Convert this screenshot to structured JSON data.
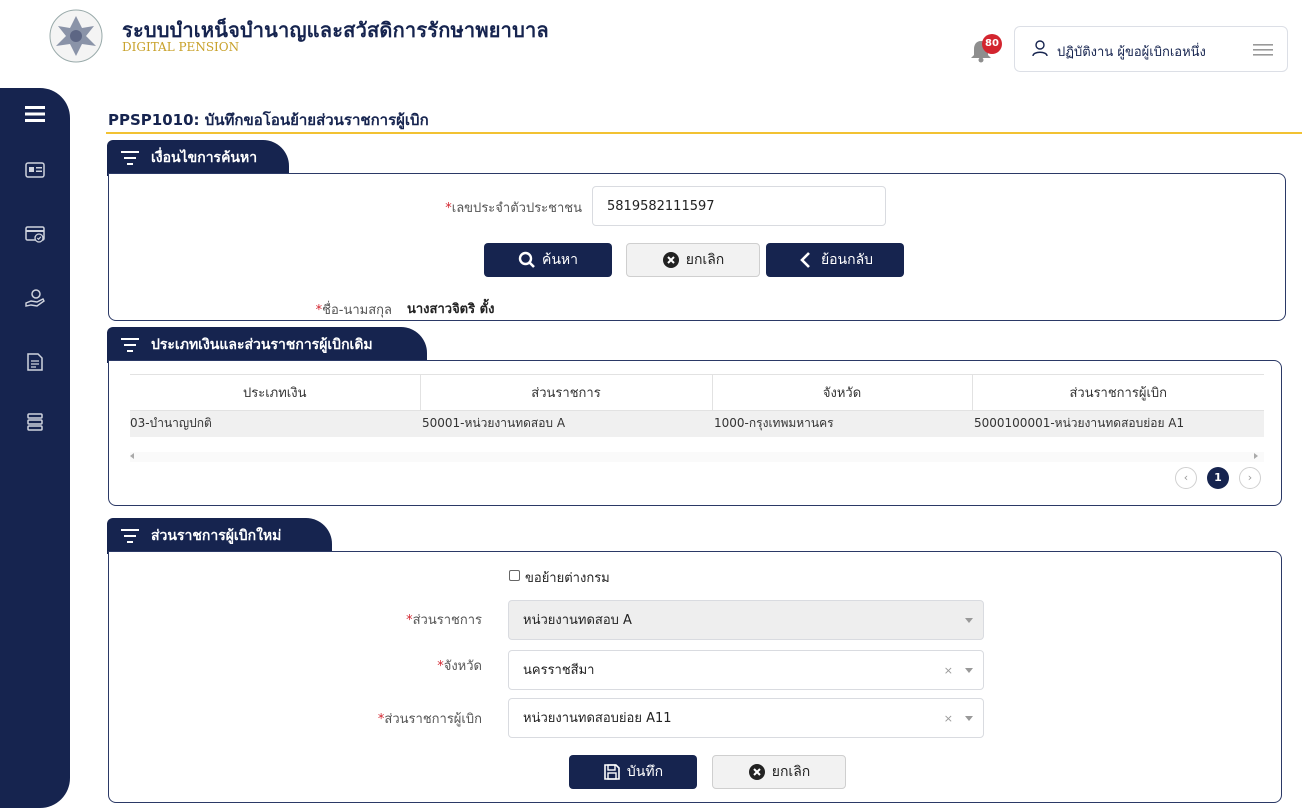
{
  "header": {
    "title": "ระบบบำเหน็จบำนาญและสวัสดิการรักษาพยาบาล",
    "subtitle": "DIGITAL PENSION",
    "notification_count": "80",
    "user_name": "ปฏิบัติงาน ผู้ขอผู้เบิกเอหนึ่ง"
  },
  "page": {
    "title": "PPSP1010: บันทึกขอโอนย้ายส่วนราชการผู้เบิก"
  },
  "search_section": {
    "tab": "เงื่อนไขการค้นหา",
    "id_label": "เลขประจำตัวประชาชน",
    "id_value": "5819582111597",
    "search_button": "ค้นหา",
    "cancel_button": "ยกเลิก",
    "back_button": "ย้อนกลับ",
    "name_label": "ชื่อ-นามสกุล",
    "name_value": "นางสาวจิตริ ตั้ง"
  },
  "old_section": {
    "tab": "ประเภทเงินและส่วนราชการผู้เบิกเดิม",
    "columns": [
      "ประเภทเงิน",
      "ส่วนราชการ",
      "จังหวัด",
      "ส่วนราชการผู้เบิก"
    ],
    "rows": [
      [
        "03-บำนาญปกติ",
        "50001-หน่วยงานทดสอบ A",
        "1000-กรุงเทพมหานคร",
        "5000100001-หน่วยงานทดสอบย่อย A1"
      ]
    ],
    "pagination": {
      "current": "1"
    }
  },
  "new_section": {
    "tab": "ส่วนราชการผู้เบิกใหม่",
    "transfer_checkbox_label": "ขอย้ายต่างกรม",
    "agency_label": "ส่วนราชการ",
    "agency_value": "หน่วยงานทดสอบ A",
    "province_label": "จังหวัด",
    "province_value": "นครราชสีมา",
    "disbursing_label": "ส่วนราชการผู้เบิก",
    "disbursing_value": "หน่วยงานทดสอบย่อย A11",
    "clear_symbol": "×",
    "save_button": "บันทึก",
    "cancel_button": "ยกเลิก"
  },
  "colors": {
    "navy": "#16244f",
    "gold": "#f2c232",
    "badge": "#d3252f"
  }
}
